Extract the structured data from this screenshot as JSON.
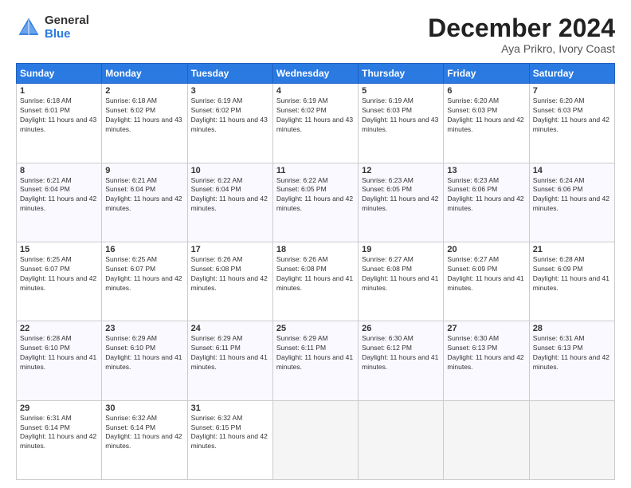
{
  "logo": {
    "general": "General",
    "blue": "Blue"
  },
  "title": "December 2024",
  "subtitle": "Aya Prikro, Ivory Coast",
  "days_of_week": [
    "Sunday",
    "Monday",
    "Tuesday",
    "Wednesday",
    "Thursday",
    "Friday",
    "Saturday"
  ],
  "weeks": [
    [
      {
        "day": 1,
        "sunrise": "6:18 AM",
        "sunset": "6:01 PM",
        "daylight": "11 hours and 43 minutes."
      },
      {
        "day": 2,
        "sunrise": "6:18 AM",
        "sunset": "6:02 PM",
        "daylight": "11 hours and 43 minutes."
      },
      {
        "day": 3,
        "sunrise": "6:19 AM",
        "sunset": "6:02 PM",
        "daylight": "11 hours and 43 minutes."
      },
      {
        "day": 4,
        "sunrise": "6:19 AM",
        "sunset": "6:02 PM",
        "daylight": "11 hours and 43 minutes."
      },
      {
        "day": 5,
        "sunrise": "6:19 AM",
        "sunset": "6:03 PM",
        "daylight": "11 hours and 43 minutes."
      },
      {
        "day": 6,
        "sunrise": "6:20 AM",
        "sunset": "6:03 PM",
        "daylight": "11 hours and 42 minutes."
      },
      {
        "day": 7,
        "sunrise": "6:20 AM",
        "sunset": "6:03 PM",
        "daylight": "11 hours and 42 minutes."
      }
    ],
    [
      {
        "day": 8,
        "sunrise": "6:21 AM",
        "sunset": "6:04 PM",
        "daylight": "11 hours and 42 minutes."
      },
      {
        "day": 9,
        "sunrise": "6:21 AM",
        "sunset": "6:04 PM",
        "daylight": "11 hours and 42 minutes."
      },
      {
        "day": 10,
        "sunrise": "6:22 AM",
        "sunset": "6:04 PM",
        "daylight": "11 hours and 42 minutes."
      },
      {
        "day": 11,
        "sunrise": "6:22 AM",
        "sunset": "6:05 PM",
        "daylight": "11 hours and 42 minutes."
      },
      {
        "day": 12,
        "sunrise": "6:23 AM",
        "sunset": "6:05 PM",
        "daylight": "11 hours and 42 minutes."
      },
      {
        "day": 13,
        "sunrise": "6:23 AM",
        "sunset": "6:06 PM",
        "daylight": "11 hours and 42 minutes."
      },
      {
        "day": 14,
        "sunrise": "6:24 AM",
        "sunset": "6:06 PM",
        "daylight": "11 hours and 42 minutes."
      }
    ],
    [
      {
        "day": 15,
        "sunrise": "6:25 AM",
        "sunset": "6:07 PM",
        "daylight": "11 hours and 42 minutes."
      },
      {
        "day": 16,
        "sunrise": "6:25 AM",
        "sunset": "6:07 PM",
        "daylight": "11 hours and 42 minutes."
      },
      {
        "day": 17,
        "sunrise": "6:26 AM",
        "sunset": "6:08 PM",
        "daylight": "11 hours and 42 minutes."
      },
      {
        "day": 18,
        "sunrise": "6:26 AM",
        "sunset": "6:08 PM",
        "daylight": "11 hours and 41 minutes."
      },
      {
        "day": 19,
        "sunrise": "6:27 AM",
        "sunset": "6:08 PM",
        "daylight": "11 hours and 41 minutes."
      },
      {
        "day": 20,
        "sunrise": "6:27 AM",
        "sunset": "6:09 PM",
        "daylight": "11 hours and 41 minutes."
      },
      {
        "day": 21,
        "sunrise": "6:28 AM",
        "sunset": "6:09 PM",
        "daylight": "11 hours and 41 minutes."
      }
    ],
    [
      {
        "day": 22,
        "sunrise": "6:28 AM",
        "sunset": "6:10 PM",
        "daylight": "11 hours and 41 minutes."
      },
      {
        "day": 23,
        "sunrise": "6:29 AM",
        "sunset": "6:10 PM",
        "daylight": "11 hours and 41 minutes."
      },
      {
        "day": 24,
        "sunrise": "6:29 AM",
        "sunset": "6:11 PM",
        "daylight": "11 hours and 41 minutes."
      },
      {
        "day": 25,
        "sunrise": "6:29 AM",
        "sunset": "6:11 PM",
        "daylight": "11 hours and 41 minutes."
      },
      {
        "day": 26,
        "sunrise": "6:30 AM",
        "sunset": "6:12 PM",
        "daylight": "11 hours and 41 minutes."
      },
      {
        "day": 27,
        "sunrise": "6:30 AM",
        "sunset": "6:13 PM",
        "daylight": "11 hours and 42 minutes."
      },
      {
        "day": 28,
        "sunrise": "6:31 AM",
        "sunset": "6:13 PM",
        "daylight": "11 hours and 42 minutes."
      }
    ],
    [
      {
        "day": 29,
        "sunrise": "6:31 AM",
        "sunset": "6:14 PM",
        "daylight": "11 hours and 42 minutes."
      },
      {
        "day": 30,
        "sunrise": "6:32 AM",
        "sunset": "6:14 PM",
        "daylight": "11 hours and 42 minutes."
      },
      {
        "day": 31,
        "sunrise": "6:32 AM",
        "sunset": "6:15 PM",
        "daylight": "11 hours and 42 minutes."
      },
      null,
      null,
      null,
      null
    ]
  ]
}
